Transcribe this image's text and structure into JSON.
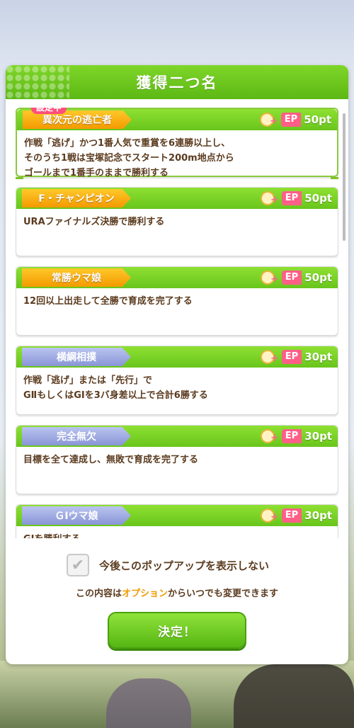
{
  "dialog": {
    "title": "獲得二つ名"
  },
  "selected_badge": "設定中",
  "titles": [
    {
      "name": "異次元の逃亡者",
      "tier": "gold",
      "ep_label": "EP",
      "points": "50pt",
      "description": "作戦「逃げ」かつ1番人気で重賞を6連勝以上し、\nそのうち1戦は宝塚記念でスタート200m地点から\nゴールまで1番手のままで勝利する",
      "selected": true
    },
    {
      "name": "F・チャンピオン",
      "tier": "gold",
      "ep_label": "EP",
      "points": "50pt",
      "description": "URAファイナルズ決勝で勝利する",
      "selected": false
    },
    {
      "name": "常勝ウマ娘",
      "tier": "gold",
      "ep_label": "EP",
      "points": "50pt",
      "description": "12回以上出走して全勝で育成を完了する",
      "selected": false
    },
    {
      "name": "横綱相撲",
      "tier": "silver",
      "ep_label": "EP",
      "points": "30pt",
      "description": "作戦「逃げ」または「先行」で\nGⅡもしくはGⅠを3バ身差以上で合計6勝する",
      "selected": false
    },
    {
      "name": "完全無欠",
      "tier": "silver",
      "ep_label": "EP",
      "points": "30pt",
      "description": "目標を全て達成し、無敗で育成を完了する",
      "selected": false
    },
    {
      "name": "ＧⅠウマ娘",
      "tier": "silver",
      "ep_label": "EP",
      "points": "30pt",
      "description": "GⅠを勝利する",
      "selected": false
    }
  ],
  "checkbox": {
    "label": "今後このポップアップを表示しない",
    "checked": true
  },
  "note": {
    "prefix": "この内容は",
    "highlight": "オプション",
    "suffix": "からいつでも変更できます"
  },
  "decide_button": "決定！"
}
